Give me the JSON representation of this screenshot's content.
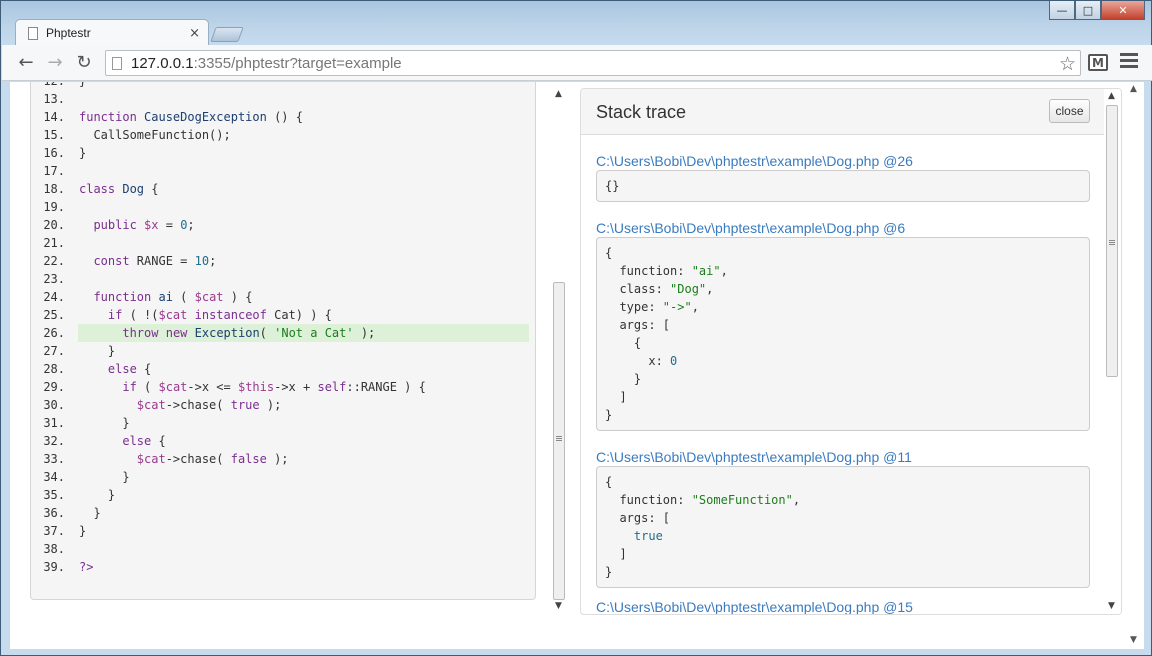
{
  "window": {
    "min_label": "—",
    "max_label": "□",
    "close_label": "✕"
  },
  "tab": {
    "title": "Phptestr",
    "close_label": "×"
  },
  "toolbar": {
    "back_label": "←",
    "forward_label": "→",
    "reload_label": "↻",
    "url_host": "127.0.0.1",
    "url_rest": ":3355/phptestr?target=example",
    "star_label": "☆",
    "gmail_label": "M"
  },
  "code": {
    "highlighted_line": 26,
    "lines": [
      {
        "n": "12.",
        "html": "}"
      },
      {
        "n": "13.",
        "html": ""
      },
      {
        "n": "14.",
        "html": "<span class=\"kw\">function</span> <span class=\"fn\">CauseDogException</span> () {"
      },
      {
        "n": "15.",
        "html": "  CallSomeFunction();"
      },
      {
        "n": "16.",
        "html": "}"
      },
      {
        "n": "17.",
        "html": ""
      },
      {
        "n": "18.",
        "html": "<span class=\"kw\">class</span> <span class=\"fn\">Dog</span> {"
      },
      {
        "n": "19.",
        "html": ""
      },
      {
        "n": "20.",
        "html": "  <span class=\"kw\">public</span> <span class=\"var\">$x</span> = <span class=\"num-lit\">0</span>;"
      },
      {
        "n": "21.",
        "html": ""
      },
      {
        "n": "22.",
        "html": "  <span class=\"kw\">const</span> RANGE = <span class=\"num-lit\">10</span>;"
      },
      {
        "n": "23.",
        "html": ""
      },
      {
        "n": "24.",
        "html": "  <span class=\"kw\">function</span> <span class=\"fn\">ai</span> ( <span class=\"var\">$cat</span> ) {"
      },
      {
        "n": "25.",
        "html": "    <span class=\"kw\">if</span> ( !(<span class=\"var\">$cat</span> <span class=\"kw\">instanceof</span> Cat) ) {"
      },
      {
        "n": "26.",
        "html": "      <span class=\"kw\">throw</span> <span class=\"kw\">new</span> <span class=\"fn\">Exception</span>( <span class=\"str\">'Not a Cat'</span> );"
      },
      {
        "n": "27.",
        "html": "    }"
      },
      {
        "n": "28.",
        "html": "    <span class=\"kw\">else</span> {"
      },
      {
        "n": "29.",
        "html": "      <span class=\"kw\">if</span> ( <span class=\"var\">$cat</span>-&gt;x &lt;= <span class=\"var\">$this</span>-&gt;x + <span class=\"kw\">self</span>::RANGE ) {"
      },
      {
        "n": "30.",
        "html": "        <span class=\"var\">$cat</span>-&gt;chase( <span class=\"bool\">true</span> );"
      },
      {
        "n": "31.",
        "html": "      }"
      },
      {
        "n": "32.",
        "html": "      <span class=\"kw\">else</span> {"
      },
      {
        "n": "33.",
        "html": "        <span class=\"var\">$cat</span>-&gt;chase( <span class=\"bool\">false</span> );"
      },
      {
        "n": "34.",
        "html": "      }"
      },
      {
        "n": "35.",
        "html": "    }"
      },
      {
        "n": "36.",
        "html": "  }"
      },
      {
        "n": "37.",
        "html": "}"
      },
      {
        "n": "38.",
        "html": ""
      },
      {
        "n": "39.",
        "html": "<span class=\"kw\">?&gt;</span>"
      }
    ]
  },
  "trace": {
    "title": "Stack trace",
    "close_label": "close",
    "frames": [
      {
        "link": "C:\\Users\\Bobi\\Dev\\phptestr\\example\\Dog.php @26",
        "body": "{}"
      },
      {
        "link": "C:\\Users\\Bobi\\Dev\\phptestr\\example\\Dog.php @6",
        "body": "{\n  function: <span class=\"str\">\"ai\"</span>,\n  class: <span class=\"str\">\"Dog\"</span>,\n  type: <span class=\"str\">\"-&gt;\"</span>,\n  args: [\n    {\n      x: <span class=\"num-lit\">0</span>\n    }\n  ]\n}"
      },
      {
        "link": "C:\\Users\\Bobi\\Dev\\phptestr\\example\\Dog.php @11",
        "body": "{\n  function: <span class=\"str\">\"SomeFunction\"</span>,\n  args: [\n    <span class=\"num-lit\">true</span>\n  ]\n}"
      },
      {
        "link": "C:\\Users\\Bobi\\Dev\\phptestr\\example\\Dog.php @15",
        "body": ""
      }
    ]
  }
}
